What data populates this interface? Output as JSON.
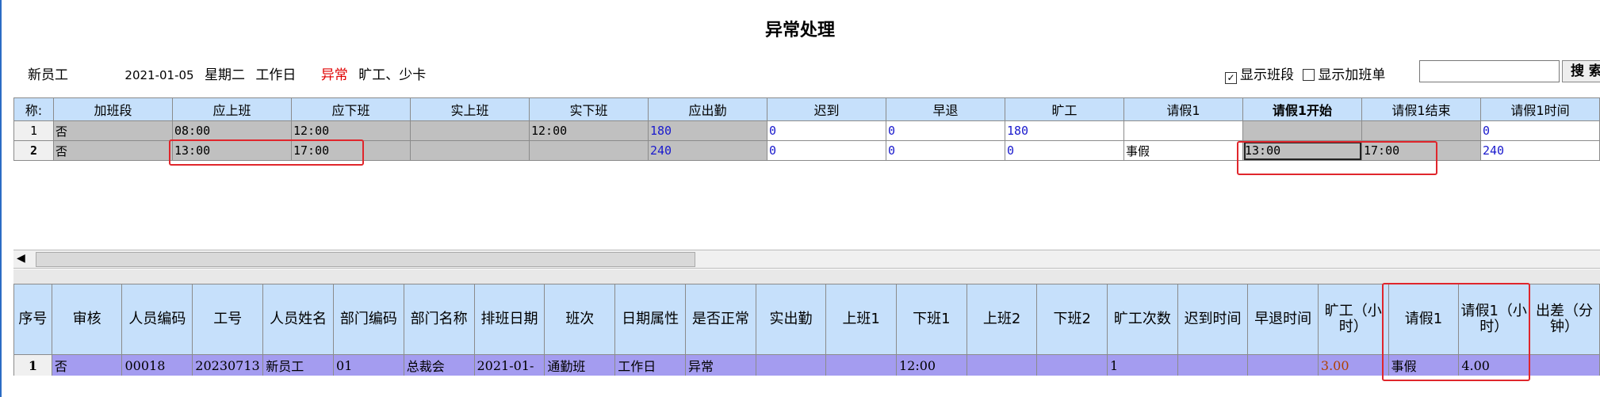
{
  "title": "异常处理",
  "info": {
    "employee": "新员工",
    "date": "2021-01-05",
    "weekday": "星期二",
    "day_type": "工作日",
    "status": "异常",
    "reason": "旷工、少卡"
  },
  "options": {
    "show_shift": "显示班段",
    "show_shift_checked": true,
    "show_overtime": "显示加班单",
    "show_overtime_checked": false,
    "search_value": "",
    "search_label": "搜 索"
  },
  "grid1": {
    "corner": "称:",
    "headers": [
      "加班段",
      "应上班",
      "应下班",
      "实上班",
      "实下班",
      "应出勤",
      "迟到",
      "早退",
      "旷工",
      "请假1",
      "请假1开始",
      "请假1结束",
      "请假1时间"
    ],
    "rows": [
      {
        "num": "1",
        "cells": [
          "否",
          "08:00",
          "12:00",
          "",
          "12:00",
          "180",
          "0",
          "0",
          "180",
          "",
          "",
          "",
          "0"
        ]
      },
      {
        "num": "2",
        "cells": [
          "否",
          "13:00",
          "17:00",
          "",
          "",
          "240",
          "0",
          "0",
          "0",
          "事假",
          "13:00",
          "17:00",
          "240"
        ]
      }
    ]
  },
  "grid2": {
    "headers": [
      "序号",
      "审核",
      "人员编码",
      "工号",
      "人员姓名",
      "部门编码",
      "部门名称",
      "排班日期",
      "班次",
      "日期属性",
      "是否正常",
      "实出勤",
      "上班1",
      "下班1",
      "上班2",
      "下班2",
      "旷工次数",
      "迟到时间",
      "早退时间",
      "旷工（小时）",
      "请假1",
      "请假1（小时）",
      "出差（分钟）"
    ],
    "rows": [
      {
        "num": "1",
        "cells": [
          "否",
          "00018",
          "20230713",
          "新员工",
          "01",
          "总裁会",
          "2021-01-",
          "通勤班",
          "工作日",
          "异常",
          "",
          "",
          "12:00",
          "",
          "",
          "1",
          "",
          "",
          "3.00",
          "事假",
          "4.00",
          ""
        ]
      }
    ]
  },
  "colors": {
    "header": "#c6e0fb",
    "gray": "#c0c0c0",
    "row_purple": "#a49cf0",
    "highlight": "#e0262c"
  }
}
